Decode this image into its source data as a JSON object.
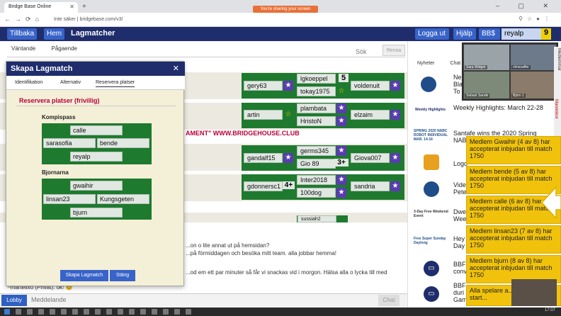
{
  "browser": {
    "tab_title": "Bridge Base Online",
    "sharing_banner": "You're sharing your screen",
    "url": "Inte säker | bridgebase.com/v3/",
    "window_controls": "– ▢ ✕"
  },
  "nav": {
    "back_label": "Tillbaka",
    "home_label": "Hem",
    "title": "Lagmatcher",
    "logout_label": "Logga ut",
    "help_label": "Hjälp",
    "bbs_label": "BB$",
    "username": "reyalp",
    "count": "9"
  },
  "left": {
    "tab_waiting": "Väntande",
    "tab_ongoing": "Pågaende",
    "search_label": "Sök",
    "reset_label": "Rensa",
    "event_text": "AMENT\" WWW.BRIDGEHOUSE.CLUB",
    "tables": [
      {
        "west": "gery63",
        "north": "lgkoeppel",
        "north_score": "5",
        "south": "tokay1975",
        "east": "voldenuit"
      },
      {
        "west": "artin",
        "north": "plambata",
        "south": "HristoN",
        "east": "elzaim"
      },
      {
        "west": "gandalf15",
        "north": "germs345",
        "south": "Gio 89",
        "south_score": "3+",
        "east": "Giova007"
      },
      {
        "west": "gdonnersc1",
        "west_score": "4+",
        "north": "Inter2018",
        "south": "100dog",
        "east": "sandria"
      }
    ],
    "last_name_partial": "sussiah2"
  },
  "chat": {
    "line1": "...on o lite annat ut på hemsidan?",
    "line2": "...på förmiddagen och besöka mitt team. alla jobbar hemma!",
    "line3": "...od em ett par minuter så får vi snackas vid i morgon. Hälsa alla o lycka till med",
    "line4": "~martelixo (Privat): ok! 😊",
    "lobby_label": "Lobby",
    "input_placeholder": "Meddelande",
    "send_label": "Chat"
  },
  "modal": {
    "title": "Skapa Lagmatch",
    "tab_identification": "Identifikation",
    "tab_alternative": "Alternativ",
    "tab_reserve": "Reservera platser",
    "section_title": "Reservera platser (frivillig)",
    "team1_label": "Kompispass",
    "team1": {
      "north": "calle",
      "west": "sarasofia",
      "east": "bende",
      "south": "reyalp"
    },
    "team2_label": "Bjornarna",
    "team2": {
      "north": "gwaihir",
      "west": "linsan23",
      "east": "Kungsgeten",
      "south": "bjurn"
    },
    "create_label": "Skapa Lagmatch",
    "close_label": "Stäng"
  },
  "right": {
    "tab_news": "Nyheter",
    "tab_chat": "Chat",
    "news": [
      {
        "logo": "",
        "text": "Ne\nBla\nTo"
      },
      {
        "logo": "Weekly Highlights",
        "text": "Weekly Highlights: March 22-28"
      },
      {
        "logo": "SPRING 2020 NABC ROBOT INDIVIDUAL MAR. 14-16",
        "text": "Santafe wins the 2020 Spring NAB"
      },
      {
        "logo": "",
        "text": "Logo"
      },
      {
        "logo": "",
        "text": "Vide\nPete"
      },
      {
        "logo": "3-Day Free Weekend Event",
        "text": "Dwe\nWee"
      },
      {
        "logo": "Free Super Sunday Daylong",
        "text": "Hey\nDay"
      },
      {
        "logo": "",
        "text": "BBF\nconv"
      },
      {
        "logo": "",
        "text": "BBF\nduri\nGam"
      }
    ],
    "video_names": [
      "Sara Widget",
      "chrisvaffer",
      "Sebast Sande",
      "Björn 1"
    ],
    "side_tab": "Medlemmar",
    "side_tab2": "Manniskor",
    "notifications": [
      "Medlem Gwaihir (4 av 8) har accepterat inbjudan till match 1750",
      "Medlem bende (5 av 8) har accepterat inbjudan till match 1750",
      "Medlem calle (6 av 8) har accepterat inbjudan till match 1750",
      "Medlem linsan23 (7 av 8) har accepterat inbjudan till match 1750",
      "Medlem bjurn (8 av 8) har accepterat inbjudan till match 1750",
      "Alla spelare a... Matchen start..."
    ]
  },
  "taskbar": {
    "clock": "17:07"
  }
}
